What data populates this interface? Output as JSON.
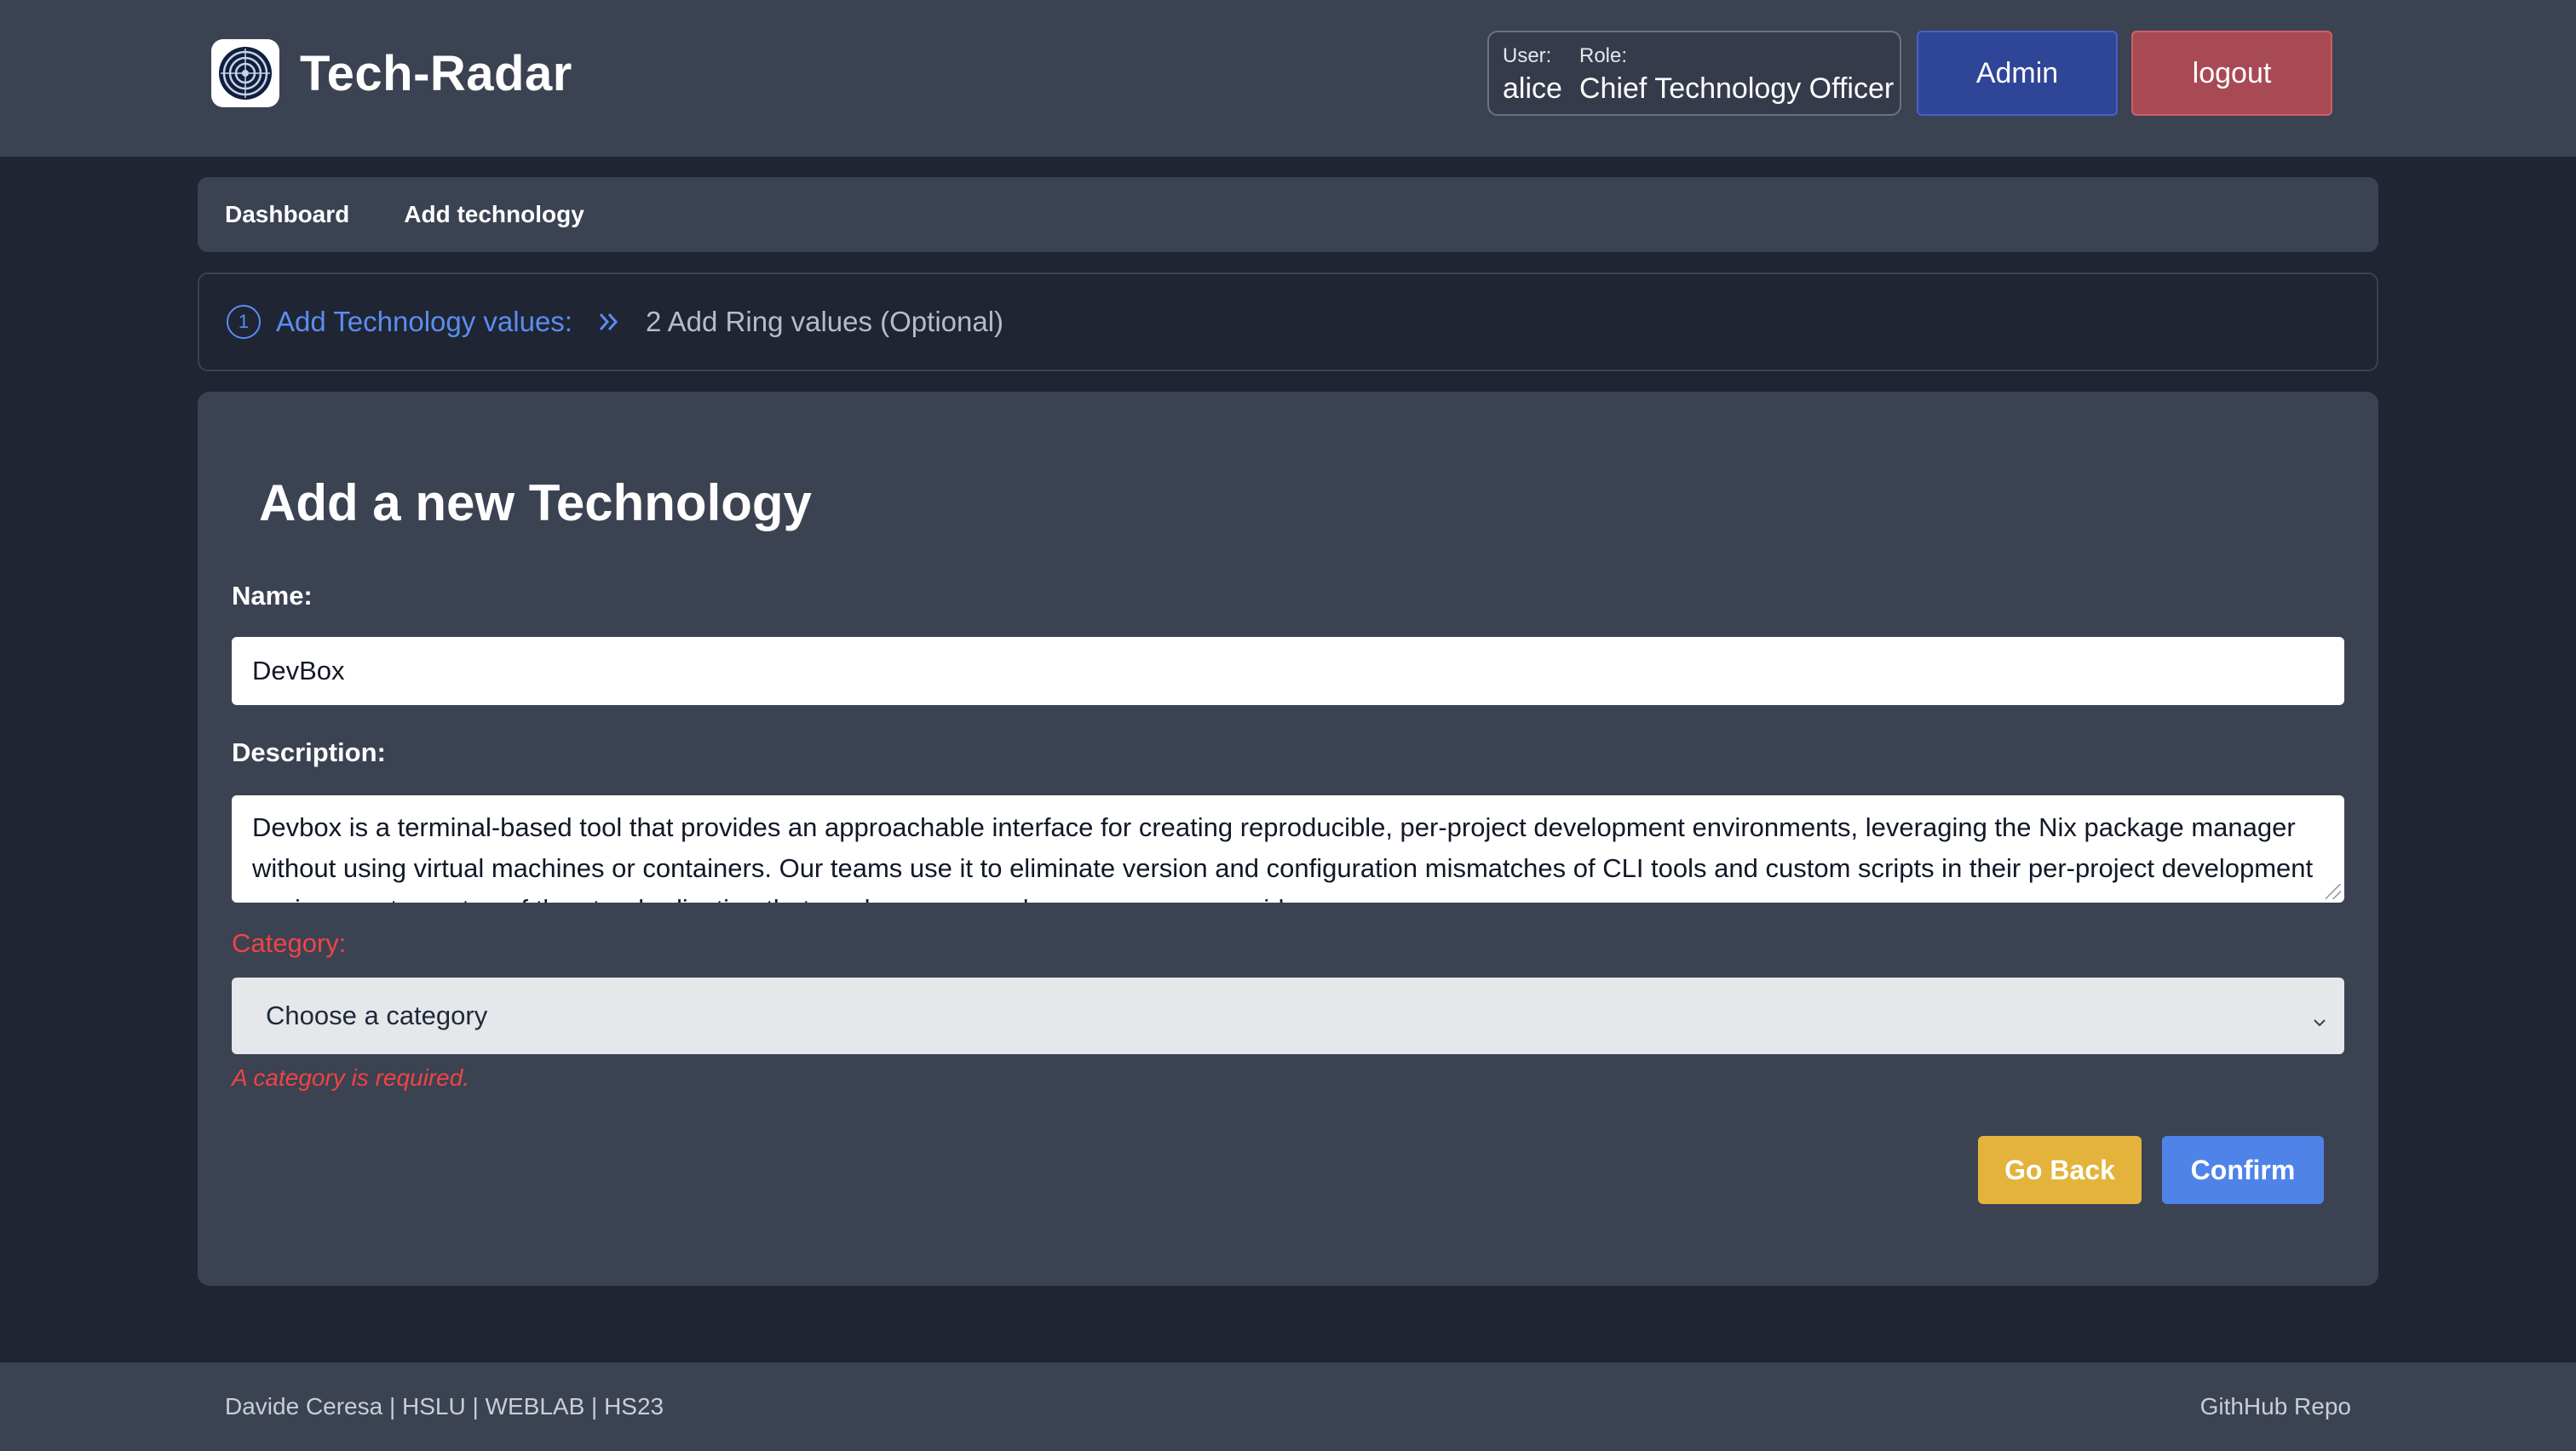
{
  "header": {
    "app_name": "Tech-Radar",
    "user_label": "User:",
    "user_value": "alice",
    "role_label": "Role:",
    "role_value": "Chief Technology Officer",
    "admin_label": "Admin",
    "logout_label": "logout"
  },
  "nav": {
    "items": [
      "Dashboard",
      "Add technology"
    ]
  },
  "stepper": {
    "step1_number": "1",
    "step1_label": "Add Technology values:",
    "step2_label": "2 Add Ring values (Optional)"
  },
  "form": {
    "title": "Add a new Technology",
    "name_label": "Name:",
    "name_value": "DevBox",
    "description_label": "Description:",
    "description_value": "Devbox is a terminal-based tool that provides an approachable interface for creating reproducible, per-project development environments, leveraging the Nix package manager without using virtual machines or containers. Our teams use it to eliminate version and configuration mismatches of CLI tools and custom scripts in their per-project development environments, on top of the standardization that per-language package managers provide.",
    "category_label": "Category:",
    "category_selected": "Choose a category",
    "category_error": "A category is required.",
    "go_back_label": "Go Back",
    "confirm_label": "Confirm"
  },
  "footer": {
    "credits": "Davide Ceresa | HSLU | WEBLAB | HS23",
    "repo_link": "GithHub Repo"
  },
  "colors": {
    "header_bg": "#3b4252",
    "page_bg": "#1f2533",
    "accent_blue": "#5b8def",
    "admin_button": "#2f4597",
    "logout_button": "#a84a53",
    "go_back_button": "#e3b33b",
    "confirm_button": "#4f83e8",
    "error_red": "#ef4444"
  }
}
